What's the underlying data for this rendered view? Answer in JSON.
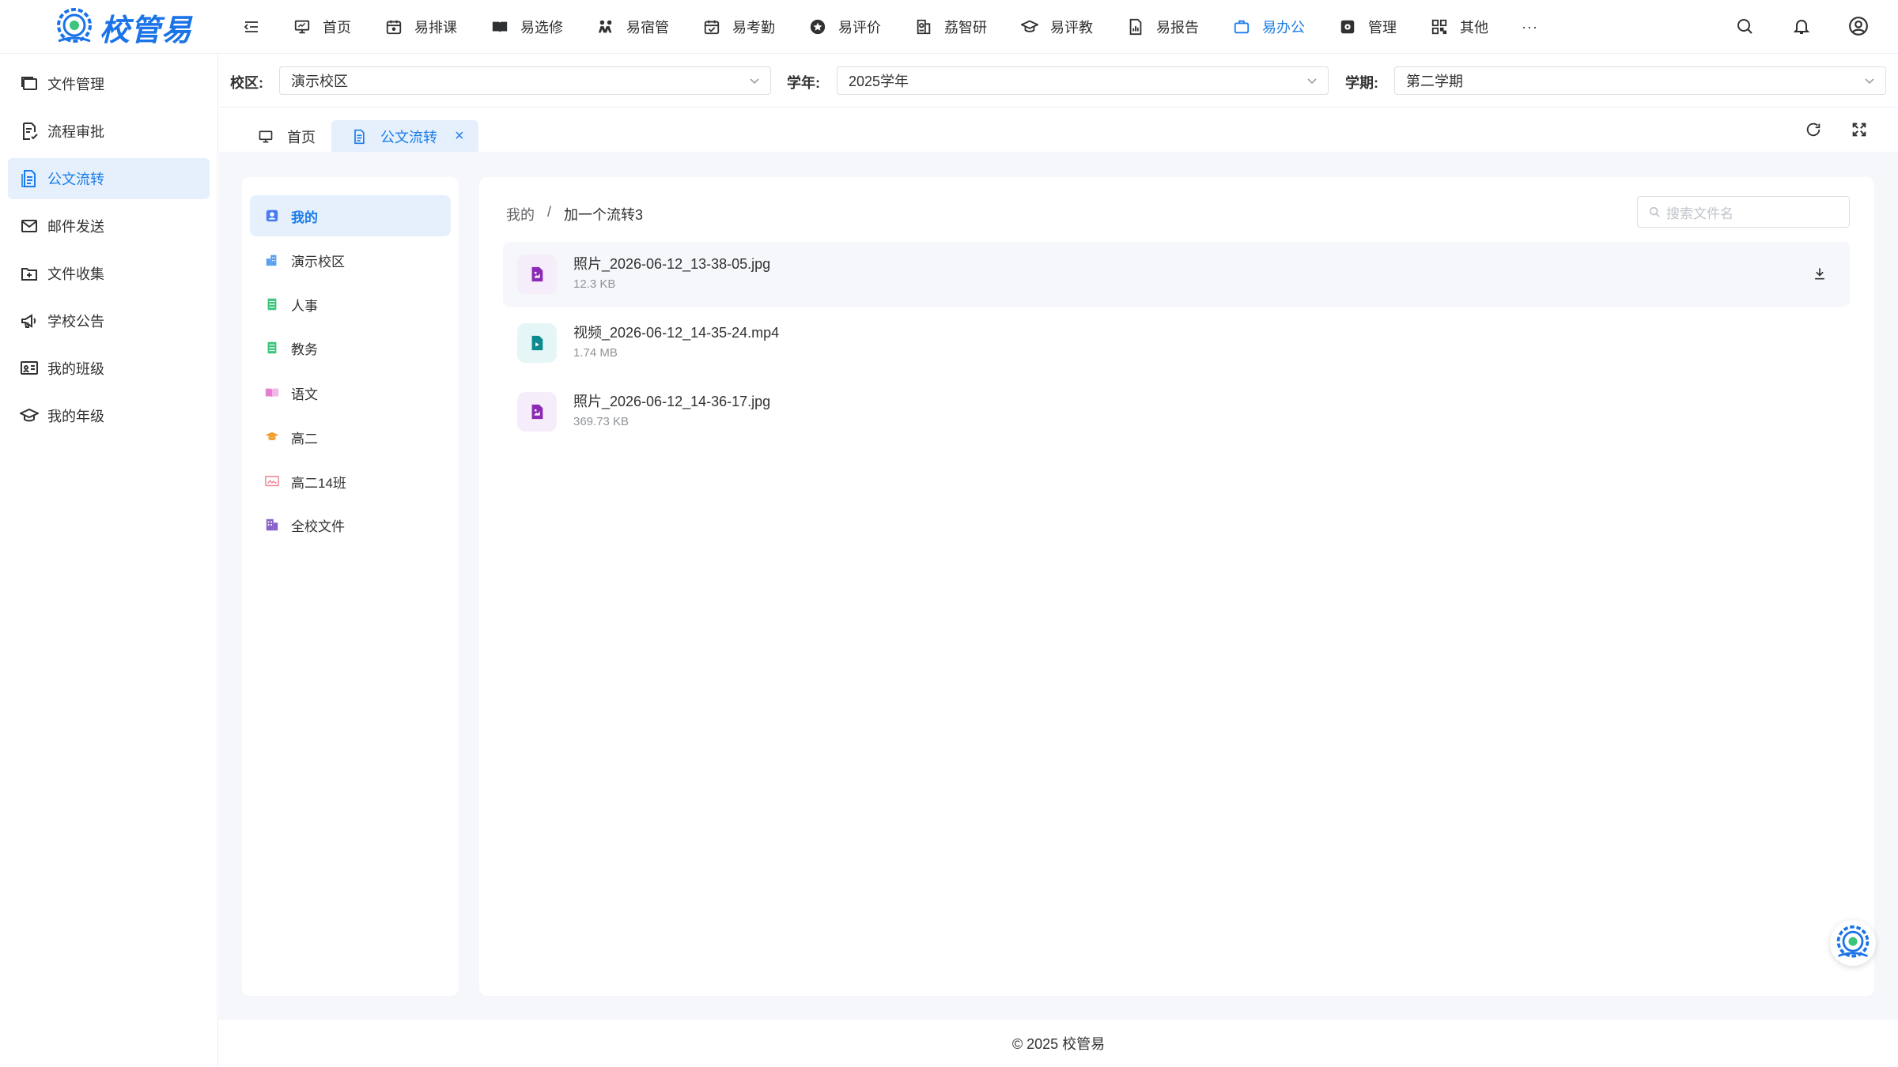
{
  "app": {
    "logo_text": "校管易"
  },
  "nav": {
    "items": [
      {
        "label": "首页",
        "icon": "monitor-icon"
      },
      {
        "label": "易排课",
        "icon": "calendar-icon"
      },
      {
        "label": "易选修",
        "icon": "book-open-icon"
      },
      {
        "label": "易宿管",
        "icon": "people-icon"
      },
      {
        "label": "易考勤",
        "icon": "calendar-check-icon"
      },
      {
        "label": "易评价",
        "icon": "star-icon"
      },
      {
        "label": "荔智研",
        "icon": "research-icon"
      },
      {
        "label": "易评教",
        "icon": "graduation-cap-icon"
      },
      {
        "label": "易报告",
        "icon": "report-icon"
      },
      {
        "label": "易办公",
        "icon": "briefcase-icon"
      },
      {
        "label": "管理",
        "icon": "settings-icon"
      },
      {
        "label": "其他",
        "icon": "grid-icon"
      }
    ],
    "more": "···",
    "active": "易办公",
    "accent": "#1a7de8"
  },
  "sidebar": {
    "items": [
      {
        "label": "文件管理",
        "icon": "folders-icon"
      },
      {
        "label": "流程审批",
        "icon": "approval-icon"
      },
      {
        "label": "公文流转",
        "icon": "document-icon"
      },
      {
        "label": "邮件发送",
        "icon": "mail-icon"
      },
      {
        "label": "文件收集",
        "icon": "folder-inbox-icon"
      },
      {
        "label": "学校公告",
        "icon": "megaphone-icon"
      },
      {
        "label": "我的班级",
        "icon": "class-board-icon"
      },
      {
        "label": "我的年级",
        "icon": "graduation-cap-icon"
      }
    ],
    "active": "公文流转"
  },
  "filters": {
    "campus_label": "校区:",
    "campus_value": "演示校区",
    "year_label": "学年:",
    "year_value": "2025学年",
    "term_label": "学期:",
    "term_value": "第二学期"
  },
  "tabs": {
    "home": "首页",
    "active": "公文流转",
    "close": "×"
  },
  "categories": {
    "items": [
      {
        "label": "我的",
        "icon": "user-card-icon",
        "color": "#4a7cf0"
      },
      {
        "label": "演示校区",
        "icon": "building-icon",
        "color": "#5aa0f0"
      },
      {
        "label": "人事",
        "icon": "ledger-icon",
        "color": "#3cc47c"
      },
      {
        "label": "教务",
        "icon": "ledger-icon",
        "color": "#3cc47c"
      },
      {
        "label": "语文",
        "icon": "open-book-icon",
        "color": "#e67fd2"
      },
      {
        "label": "高二",
        "icon": "graduation-cap-icon",
        "color": "#f0a030"
      },
      {
        "label": "高二14班",
        "icon": "class-board-icon",
        "color": "#f07a8a"
      },
      {
        "label": "全校文件",
        "icon": "buildings-icon",
        "color": "#8a62c9"
      }
    ],
    "active": "我的"
  },
  "breadcrumb": {
    "root": "我的",
    "sep": "/",
    "current": "加一个流转3"
  },
  "search": {
    "placeholder": "搜索文件名"
  },
  "files": [
    {
      "name": "照片_2026-06-12_13-38-05.jpg",
      "size": "12.3 KB",
      "type": "image",
      "icon": "image-file-icon",
      "color": "#8b2bb5",
      "bg": "#f6edfa"
    },
    {
      "name": "视频_2026-06-12_14-35-24.mp4",
      "size": "1.74 MB",
      "type": "video",
      "icon": "video-file-icon",
      "color": "#0e8a8f",
      "bg": "#e6f6f6"
    },
    {
      "name": "照片_2026-06-12_14-36-17.jpg",
      "size": "369.73 KB",
      "type": "image",
      "icon": "image-file-icon",
      "color": "#8b2bb5",
      "bg": "#f6edfa"
    }
  ],
  "footer": {
    "text": "© 2025 校管易"
  }
}
